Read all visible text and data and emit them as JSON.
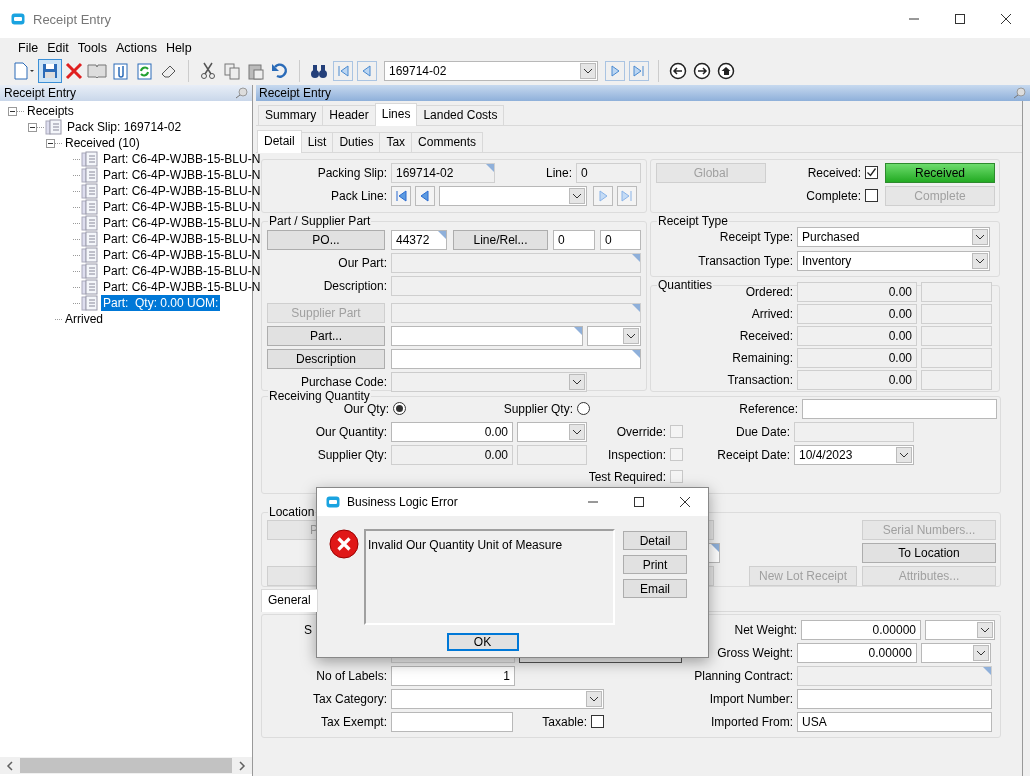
{
  "window": {
    "title": "Receipt Entry"
  },
  "menu": [
    "File",
    "Edit",
    "Tools",
    "Actions",
    "Help"
  ],
  "toolbar": {
    "record": "169714-02"
  },
  "tree_panel": {
    "title": "Receipt Entry",
    "tree": [
      {
        "label": "Receipts",
        "kind": "group",
        "expanded": true,
        "selected": false,
        "children": [
          {
            "label": "Pack Slip: 169714-02",
            "kind": "document",
            "expanded": true,
            "selected": false,
            "children": [
              {
                "label": "Received (10)",
                "kind": "group",
                "expanded": true,
                "selected": false,
                "children": [
                  {
                    "label": "Part: C6-4P-WJBB-15-BLU-N",
                    "kind": "document",
                    "selected": false
                  },
                  {
                    "label": "Part: C6-4P-WJBB-15-BLU-N",
                    "kind": "document",
                    "selected": false
                  },
                  {
                    "label": "Part: C6-4P-WJBB-15-BLU-N",
                    "kind": "document",
                    "selected": false
                  },
                  {
                    "label": "Part: C6-4P-WJBB-15-BLU-N",
                    "kind": "document",
                    "selected": false
                  },
                  {
                    "label": "Part: C6-4P-WJBB-15-BLU-N",
                    "kind": "document",
                    "selected": false
                  },
                  {
                    "label": "Part: C6-4P-WJBB-15-BLU-N",
                    "kind": "document",
                    "selected": false
                  },
                  {
                    "label": "Part: C6-4P-WJBB-15-BLU-N",
                    "kind": "document",
                    "selected": false
                  },
                  {
                    "label": "Part: C6-4P-WJBB-15-BLU-N",
                    "kind": "document",
                    "selected": false
                  },
                  {
                    "label": "Part: C6-4P-WJBB-15-BLU-N",
                    "kind": "document",
                    "selected": false
                  },
                  {
                    "label": "Part:  Qty: 0.00 UOM:",
                    "kind": "document",
                    "selected": true
                  }
                ]
              },
              {
                "label": "Arrived",
                "kind": "group",
                "selected": false
              }
            ]
          }
        ]
      }
    ]
  },
  "form_panel": {
    "title": "Receipt Entry",
    "tabs": [
      {
        "label": "Summary",
        "selected": false
      },
      {
        "label": "Header",
        "selected": false
      },
      {
        "label": "Lines",
        "selected": true
      },
      {
        "label": "Landed Costs",
        "selected": false
      }
    ],
    "subtabs": [
      {
        "label": "Detail",
        "selected": true
      },
      {
        "label": "List",
        "selected": false
      },
      {
        "label": "Duties",
        "selected": false
      },
      {
        "label": "Tax",
        "selected": false
      },
      {
        "label": "Comments",
        "selected": false
      }
    ]
  },
  "slip": {
    "packing_slip": {
      "label": "Packing Slip:",
      "value": "169714-02"
    },
    "line": {
      "label": "Line:",
      "value": "0"
    },
    "pack_line": {
      "label": "Pack Line:"
    }
  },
  "status": {
    "global_button": {
      "label": "Global",
      "disabled": true
    },
    "received": {
      "label": "Received:",
      "checked": true
    },
    "received_button": {
      "label": "Received",
      "on": true
    },
    "complete": {
      "label": "Complete:",
      "checked": false
    },
    "complete_button": {
      "label": "Complete",
      "on": false
    }
  },
  "part_supplier": {
    "title": "Part / Supplier Part",
    "po_button": {
      "label": "PO...",
      "disabled": false
    },
    "po": "44372",
    "line_rel_button": {
      "label": "Line/Rel...",
      "disabled": false
    },
    "line": "0",
    "release": "0",
    "our_part": {
      "label": "Our Part:"
    },
    "description": {
      "label": "Description:"
    },
    "supplier_part_button": {
      "label": "Supplier Part",
      "disabled": true
    },
    "part_button": {
      "label": "Part...",
      "disabled": false
    },
    "description_button": {
      "label": "Description",
      "disabled": false
    },
    "purchase_code": {
      "label": "Purchase Code:"
    }
  },
  "receipt_type": {
    "title": "Receipt Type",
    "fields": [
      {
        "label": "Receipt Type:",
        "value": "Purchased"
      },
      {
        "label": "Transaction Type:",
        "value": "Inventory"
      }
    ]
  },
  "quantities": {
    "title": "Quantities",
    "rows": [
      {
        "label": "Ordered:",
        "value": "0.00"
      },
      {
        "label": "Arrived:",
        "value": "0.00"
      },
      {
        "label": "Received:",
        "value": "0.00"
      },
      {
        "label": "Remaining:",
        "value": "0.00"
      },
      {
        "label": "Transaction:",
        "value": "0.00"
      }
    ]
  },
  "receiving_quantity": {
    "title": "Receiving Quantity",
    "our_qty_option": {
      "label": "Our Qty:",
      "selected": true
    },
    "supplier_qty_option": {
      "label": "Supplier Qty:",
      "selected": false
    },
    "our_quantity": {
      "label": "Our Quantity:",
      "value": "0.00"
    },
    "supplier_qty": {
      "label": "Supplier Qty:",
      "value": "0.00"
    },
    "checks": [
      {
        "label": "Override:",
        "checked": false,
        "disabled": true
      },
      {
        "label": "Inspection:",
        "checked": false,
        "disabled": true
      },
      {
        "label": "Test Required:",
        "checked": false,
        "disabled": true
      }
    ],
    "reference": {
      "label": "Reference:"
    },
    "due_date": {
      "label": "Due Date:"
    },
    "receipt_date": {
      "label": "Receipt Date:",
      "value": "10/4/2023"
    }
  },
  "location": {
    "title": "Location",
    "left_button": {
      "label": "P",
      "disabled": true
    },
    "buttons": [
      {
        "label": "Serial Numbers...",
        "disabled": true
      },
      {
        "label": "To Location",
        "disabled": false
      },
      {
        "label": "New Lot Receipt",
        "disabled": true
      },
      {
        "label": "Attributes...",
        "disabled": true
      }
    ]
  },
  "bottom_tabs": [
    {
      "label": "General",
      "selected": true
    }
  ],
  "general": {
    "hidden_label": "S",
    "no_of_labels": {
      "label": "No of Labels:",
      "value": "1"
    },
    "tax_category": {
      "label": "Tax Category:"
    },
    "tax_exempt": {
      "label": "Tax Exempt:"
    },
    "taxable": {
      "label": "Taxable:",
      "checked": false
    },
    "net_weight": {
      "label": "Net Weight:",
      "value": "0.00000"
    },
    "gross_weight": {
      "label": "Gross Weight:",
      "value": "0.00000"
    },
    "planning_contract": {
      "label": "Planning Contract:"
    },
    "import_number": {
      "label": "Import Number:"
    },
    "imported_from": {
      "label": "Imported From:",
      "value": "USA"
    }
  },
  "dialog": {
    "title": "Business Logic Error",
    "message": "Invalid Our Quantity Unit of Measure",
    "buttons": [
      "Detail",
      "Print",
      "Email"
    ],
    "ok": "OK"
  }
}
